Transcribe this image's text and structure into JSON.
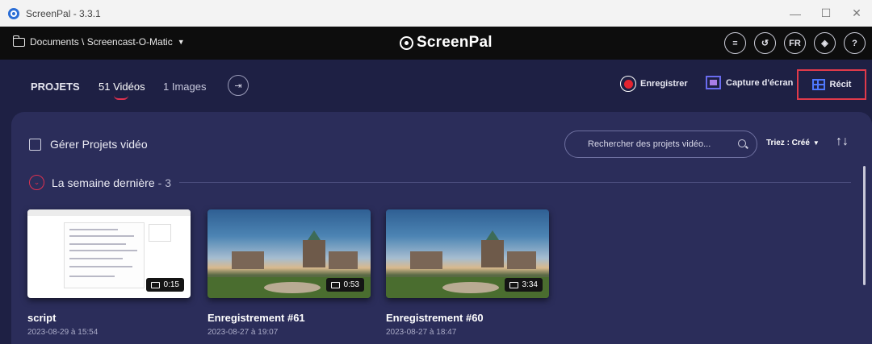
{
  "window": {
    "title": "ScreenPal - 3.3.1",
    "controls": {
      "minimize": "—",
      "maximize": "☐",
      "close": "✕"
    }
  },
  "topbar": {
    "folder_path": "Documents \\ Screencast-O-Matic",
    "logo_text": "ScreenPal",
    "icons": [
      "queue-icon",
      "history-icon",
      "language-badge",
      "layers-icon",
      "help-icon"
    ],
    "language": "FR",
    "help": "?"
  },
  "tabs": {
    "projets": "PROJETS",
    "videos": "51 Vidéos",
    "images": "1 Images"
  },
  "actions": {
    "record": "Enregistrer",
    "capture": "Capture d'écran",
    "recit": "Récit"
  },
  "toolbar": {
    "manage_label": "Gérer Projets vidéo",
    "search_placeholder": "Rechercher des projets vidéo...",
    "sort_label": "Triez : Créé",
    "sort_direction_glyph": "↑↓"
  },
  "section": {
    "title": "La semaine dernière",
    "count": "- 3"
  },
  "projects": [
    {
      "title": "script",
      "date": "2023-08-29 à 15:54",
      "duration": "0:15",
      "thumbnail": "screenshot"
    },
    {
      "title": "Enregistrement #61",
      "date": "2023-08-27 à 19:07",
      "duration": "0:53",
      "thumbnail": "chateau-photo"
    },
    {
      "title": "Enregistrement #60",
      "date": "2023-08-27 à 18:47",
      "duration": "3:34",
      "thumbnail": "chateau-photo"
    }
  ],
  "colors": {
    "accent": "#e0314f",
    "background": "#1e2044",
    "panel": "#2b2d5a",
    "record_red": "#e4232f",
    "highlight_box": "#e03a4a"
  }
}
